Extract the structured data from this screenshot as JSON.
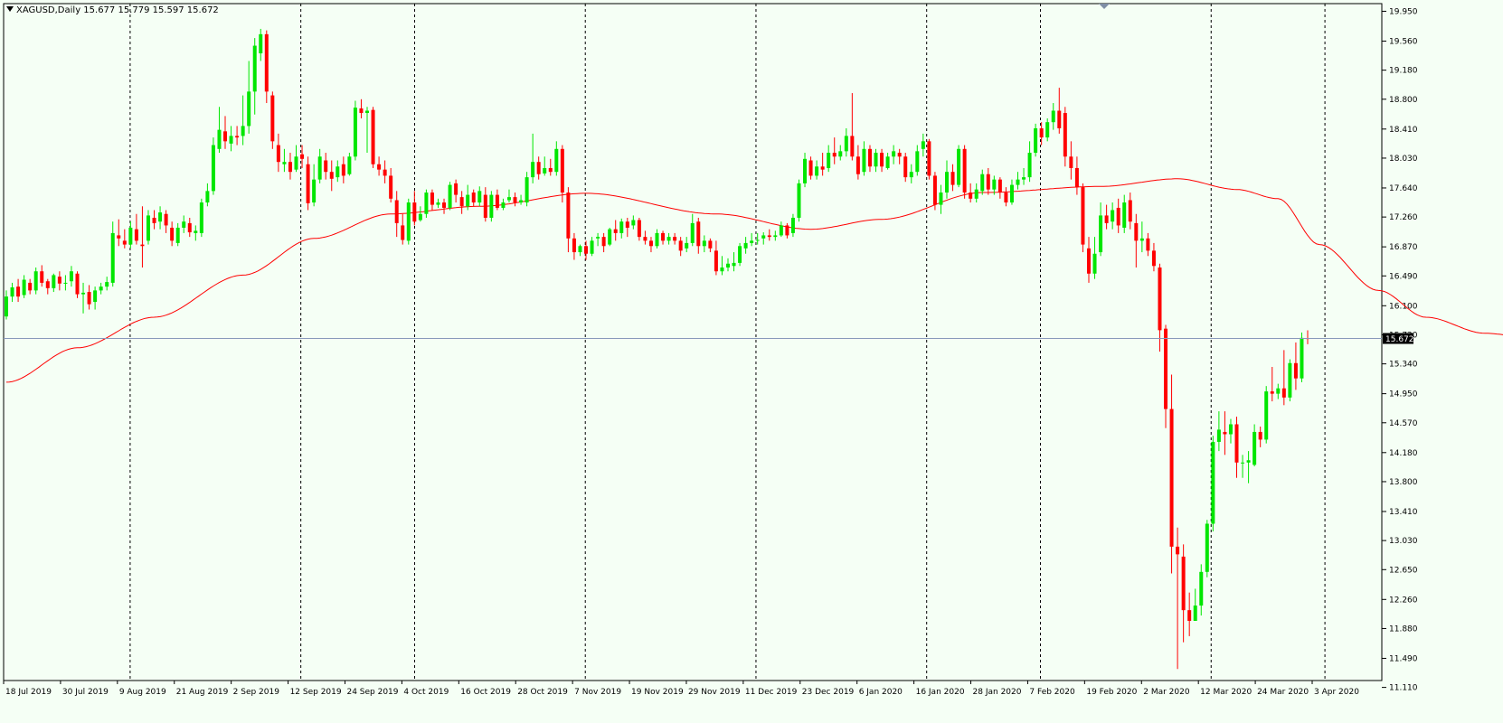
{
  "header": {
    "symbol_line": "XAGUSD,Daily  15.677 15.779 15.597 15.672"
  },
  "price_badge": "15.672",
  "colors": {
    "background": "#f5fff5",
    "bull": "#00e600",
    "bear": "#ff0000",
    "ma": "#ff0000",
    "axis": "#000000",
    "current_line": "#8899bb",
    "badge_bg": "#000000",
    "badge_fg": "#ffffff"
  },
  "chart_data": {
    "type": "candlestick",
    "symbol": "XAGUSD",
    "timeframe": "Daily",
    "ylim": [
      11.2,
      20.05
    ],
    "y_ticks": [
      "19.950",
      "19.560",
      "19.180",
      "18.800",
      "18.410",
      "18.030",
      "17.640",
      "17.260",
      "16.870",
      "16.490",
      "16.100",
      "15.720",
      "15.340",
      "14.950",
      "14.570",
      "14.180",
      "13.800",
      "13.410",
      "13.030",
      "12.650",
      "12.260",
      "11.880",
      "11.490",
      "11.110"
    ],
    "x_labels": [
      "18 Jul 2019",
      "30 Jul 2019",
      "9 Aug 2019",
      "21 Aug 2019",
      "2 Sep 2019",
      "12 Sep 2019",
      "24 Sep 2019",
      "4 Oct 2019",
      "16 Oct 2019",
      "28 Oct 2019",
      "7 Nov 2019",
      "19 Nov 2019",
      "29 Nov 2019",
      "11 Dec 2019",
      "23 Dec 2019",
      "6 Jan 2020",
      "16 Jan 2020",
      "28 Jan 2020",
      "7 Feb 2020",
      "19 Feb 2020",
      "2 Mar 2020",
      "12 Mar 2020",
      "24 Mar 2020",
      "3 Apr 2020"
    ],
    "separator_labels": [
      "30 Jul 2019",
      "2 Sep 2019",
      "24 Sep 2019",
      "28 Oct 2019",
      "29 Nov 2019",
      "6 Jan 2020",
      "28 Jan 2020",
      "2 Mar 2020",
      "24 Mar 2020"
    ],
    "last_price": 15.672,
    "ma_anchors": [
      [
        0,
        15.1
      ],
      [
        12,
        15.55
      ],
      [
        25,
        15.95
      ],
      [
        40,
        16.5
      ],
      [
        52,
        16.98
      ],
      [
        65,
        17.3
      ],
      [
        80,
        17.4
      ],
      [
        98,
        17.57
      ],
      [
        120,
        17.3
      ],
      [
        136,
        17.1
      ],
      [
        148,
        17.23
      ],
      [
        165,
        17.58
      ],
      [
        185,
        17.66
      ],
      [
        198,
        17.76
      ],
      [
        208,
        17.62
      ],
      [
        215,
        17.5
      ],
      [
        222,
        16.9
      ],
      [
        232,
        16.3
      ],
      [
        240,
        15.95
      ],
      [
        250,
        15.74
      ],
      [
        258,
        15.68
      ]
    ],
    "candles": [
      [
        15.96,
        16.22,
        15.92,
        16.3
      ],
      [
        16.22,
        16.34,
        16.15,
        16.4
      ],
      [
        16.35,
        16.22,
        16.15,
        16.45
      ],
      [
        16.24,
        16.44,
        16.2,
        16.5
      ],
      [
        16.4,
        16.3,
        16.25,
        16.45
      ],
      [
        16.3,
        16.55,
        16.25,
        16.6
      ],
      [
        16.55,
        16.4,
        16.35,
        16.63
      ],
      [
        16.42,
        16.33,
        16.25,
        16.45
      ],
      [
        16.33,
        16.5,
        16.28,
        16.52
      ],
      [
        16.48,
        16.39,
        16.3,
        16.55
      ],
      [
        16.4,
        16.4,
        16.3,
        16.5
      ],
      [
        16.42,
        16.55,
        16.35,
        16.62
      ],
      [
        16.52,
        16.25,
        16.2,
        16.55
      ],
      [
        16.25,
        16.27,
        16.0,
        16.4
      ],
      [
        16.28,
        16.12,
        16.05,
        16.37
      ],
      [
        16.15,
        16.3,
        16.05,
        16.35
      ],
      [
        16.3,
        16.35,
        16.25,
        16.4
      ],
      [
        16.35,
        16.41,
        16.3,
        16.48
      ],
      [
        16.4,
        17.05,
        16.35,
        17.2
      ],
      [
        17.02,
        16.98,
        16.88,
        17.23
      ],
      [
        16.95,
        16.9,
        16.85,
        17.1
      ],
      [
        16.9,
        17.12,
        16.85,
        17.2
      ],
      [
        17.1,
        16.95,
        16.9,
        17.3
      ],
      [
        16.9,
        16.88,
        16.6,
        17.4
      ],
      [
        16.95,
        17.28,
        16.9,
        17.35
      ],
      [
        17.25,
        17.18,
        17.1,
        17.35
      ],
      [
        17.2,
        17.32,
        17.1,
        17.4
      ],
      [
        17.3,
        17.15,
        17.05,
        17.35
      ],
      [
        17.12,
        16.95,
        16.88,
        17.2
      ],
      [
        16.92,
        17.12,
        16.88,
        17.18
      ],
      [
        17.12,
        17.2,
        17.05,
        17.28
      ],
      [
        17.18,
        17.06,
        17.0,
        17.25
      ],
      [
        17.05,
        17.08,
        16.95,
        17.15
      ],
      [
        17.05,
        17.45,
        17.0,
        17.5
      ],
      [
        17.45,
        17.6,
        17.4,
        17.7
      ],
      [
        17.6,
        18.2,
        17.55,
        18.3
      ],
      [
        18.15,
        18.4,
        18.1,
        18.7
      ],
      [
        18.38,
        18.25,
        18.15,
        18.58
      ],
      [
        18.22,
        18.32,
        18.12,
        18.45
      ],
      [
        18.32,
        18.3,
        18.2,
        18.45
      ],
      [
        18.32,
        18.45,
        18.2,
        18.85
      ],
      [
        18.45,
        18.9,
        18.35,
        19.3
      ],
      [
        18.9,
        19.5,
        18.6,
        19.6
      ],
      [
        19.4,
        19.65,
        19.3,
        19.72
      ],
      [
        19.65,
        18.9,
        18.75,
        19.7
      ],
      [
        18.85,
        18.25,
        18.15,
        18.9
      ],
      [
        18.2,
        17.98,
        17.85,
        18.35
      ],
      [
        17.95,
        17.98,
        17.85,
        18.15
      ],
      [
        17.98,
        17.85,
        17.75,
        18.1
      ],
      [
        17.88,
        18.05,
        17.85,
        18.2
      ],
      [
        18.08,
        18.02,
        17.9,
        18.2
      ],
      [
        17.95,
        17.44,
        17.35,
        18.05
      ],
      [
        17.45,
        17.75,
        17.4,
        17.95
      ],
      [
        17.75,
        18.05,
        17.7,
        18.15
      ],
      [
        18.0,
        17.85,
        17.75,
        18.1
      ],
      [
        17.85,
        17.76,
        17.6,
        18.0
      ],
      [
        17.78,
        17.92,
        17.72,
        18.0
      ],
      [
        17.95,
        17.8,
        17.7,
        18.05
      ],
      [
        17.82,
        18.05,
        17.8,
        18.1
      ],
      [
        18.05,
        18.69,
        18.0,
        18.78
      ],
      [
        18.68,
        18.62,
        18.55,
        18.8
      ],
      [
        18.62,
        18.65,
        18.1,
        18.7
      ],
      [
        18.66,
        17.95,
        17.9,
        18.7
      ],
      [
        17.95,
        17.88,
        17.8,
        18.05
      ],
      [
        17.88,
        17.8,
        17.7,
        18.0
      ],
      [
        17.8,
        17.5,
        17.45,
        17.9
      ],
      [
        17.48,
        17.18,
        17.0,
        17.6
      ],
      [
        17.15,
        16.96,
        16.9,
        17.3
      ],
      [
        16.95,
        17.45,
        16.9,
        17.5
      ],
      [
        17.45,
        17.2,
        17.15,
        17.6
      ],
      [
        17.22,
        17.3,
        17.2,
        17.4
      ],
      [
        17.3,
        17.58,
        17.25,
        17.62
      ],
      [
        17.58,
        17.42,
        17.35,
        17.62
      ],
      [
        17.42,
        17.45,
        17.38,
        17.5
      ],
      [
        17.45,
        17.38,
        17.3,
        17.5
      ],
      [
        17.38,
        17.68,
        17.35,
        17.72
      ],
      [
        17.7,
        17.55,
        17.45,
        17.75
      ],
      [
        17.52,
        17.4,
        17.3,
        17.6
      ],
      [
        17.4,
        17.55,
        17.35,
        17.68
      ],
      [
        17.58,
        17.45,
        17.4,
        17.62
      ],
      [
        17.45,
        17.6,
        17.4,
        17.66
      ],
      [
        17.55,
        17.25,
        17.2,
        17.65
      ],
      [
        17.25,
        17.55,
        17.2,
        17.6
      ],
      [
        17.55,
        17.38,
        17.35,
        17.62
      ],
      [
        17.38,
        17.45,
        17.35,
        17.5
      ],
      [
        17.48,
        17.52,
        17.45,
        17.62
      ],
      [
        17.52,
        17.45,
        17.4,
        17.58
      ],
      [
        17.45,
        17.48,
        17.42,
        17.55
      ],
      [
        17.45,
        17.78,
        17.4,
        17.85
      ],
      [
        17.78,
        17.98,
        17.7,
        18.35
      ],
      [
        17.98,
        17.82,
        17.75,
        18.05
      ],
      [
        17.83,
        17.9,
        17.8,
        18.05
      ],
      [
        17.9,
        17.85,
        17.8,
        18.02
      ],
      [
        17.85,
        18.15,
        17.8,
        18.25
      ],
      [
        18.15,
        17.58,
        17.45,
        18.2
      ],
      [
        17.58,
        16.98,
        16.8,
        17.65
      ],
      [
        16.98,
        16.8,
        16.7,
        17.05
      ],
      [
        16.8,
        16.88,
        16.75,
        16.9
      ],
      [
        16.88,
        16.78,
        16.7,
        16.95
      ],
      [
        16.78,
        16.95,
        16.75,
        17.0
      ],
      [
        16.98,
        17.0,
        16.88,
        17.05
      ],
      [
        17.0,
        16.88,
        16.8,
        17.05
      ],
      [
        16.9,
        17.1,
        16.88,
        17.12
      ],
      [
        17.1,
        17.05,
        16.95,
        17.22
      ],
      [
        17.05,
        17.2,
        16.98,
        17.24
      ],
      [
        17.2,
        17.12,
        17.0,
        17.25
      ],
      [
        17.15,
        17.22,
        17.1,
        17.28
      ],
      [
        17.22,
        17.0,
        16.95,
        17.25
      ],
      [
        17.0,
        16.95,
        16.9,
        17.08
      ],
      [
        16.95,
        16.88,
        16.8,
        17.0
      ],
      [
        16.88,
        17.05,
        16.85,
        17.1
      ],
      [
        17.05,
        16.95,
        16.9,
        17.08
      ],
      [
        16.95,
        17.0,
        16.9,
        17.05
      ],
      [
        17.0,
        16.95,
        16.9,
        17.05
      ],
      [
        16.95,
        16.82,
        16.75,
        17.0
      ],
      [
        16.85,
        16.92,
        16.8,
        17.0
      ],
      [
        16.92,
        17.18,
        16.88,
        17.3
      ],
      [
        17.2,
        16.88,
        16.78,
        17.25
      ],
      [
        16.88,
        16.95,
        16.8,
        17.02
      ],
      [
        16.95,
        16.85,
        16.8,
        16.98
      ],
      [
        16.82,
        16.55,
        16.5,
        16.95
      ],
      [
        16.55,
        16.6,
        16.5,
        16.75
      ],
      [
        16.6,
        16.65,
        16.55,
        16.72
      ],
      [
        16.62,
        16.66,
        16.55,
        16.8
      ],
      [
        16.66,
        16.88,
        16.62,
        16.92
      ],
      [
        16.85,
        16.92,
        16.78,
        17.0
      ],
      [
        16.92,
        16.95,
        16.88,
        17.05
      ],
      [
        16.95,
        16.96,
        16.9,
        17.05
      ],
      [
        16.98,
        17.02,
        16.9,
        17.06
      ],
      [
        17.02,
        17.0,
        16.95,
        17.1
      ],
      [
        17.0,
        17.02,
        16.95,
        17.08
      ],
      [
        17.02,
        17.15,
        17.0,
        17.2
      ],
      [
        17.15,
        17.02,
        16.98,
        17.18
      ],
      [
        17.05,
        17.25,
        17.0,
        17.3
      ],
      [
        17.25,
        17.7,
        17.2,
        17.75
      ],
      [
        17.7,
        18.02,
        17.65,
        18.1
      ],
      [
        18.0,
        17.8,
        17.75,
        18.05
      ],
      [
        17.8,
        17.92,
        17.75,
        18.0
      ],
      [
        17.92,
        17.88,
        17.8,
        18.1
      ],
      [
        17.9,
        18.1,
        17.85,
        18.2
      ],
      [
        18.1,
        18.05,
        17.95,
        18.3
      ],
      [
        18.05,
        18.12,
        18.0,
        18.2
      ],
      [
        18.12,
        18.32,
        18.05,
        18.42
      ],
      [
        18.32,
        18.05,
        18.0,
        18.88
      ],
      [
        18.05,
        17.82,
        17.75,
        18.2
      ],
      [
        17.85,
        18.15,
        17.8,
        18.25
      ],
      [
        18.15,
        17.92,
        17.85,
        18.2
      ],
      [
        17.92,
        18.1,
        17.85,
        18.15
      ],
      [
        18.1,
        17.92,
        17.85,
        18.15
      ],
      [
        17.9,
        18.05,
        17.88,
        18.1
      ],
      [
        18.05,
        18.12,
        17.95,
        18.2
      ],
      [
        18.1,
        18.05,
        17.95,
        18.15
      ],
      [
        18.05,
        17.78,
        17.72,
        18.1
      ],
      [
        17.78,
        17.85,
        17.7,
        17.95
      ],
      [
        17.85,
        18.12,
        17.8,
        18.2
      ],
      [
        18.15,
        18.25,
        18.05,
        18.35
      ],
      [
        18.25,
        17.8,
        17.75,
        18.28
      ],
      [
        17.8,
        17.42,
        17.35,
        17.85
      ],
      [
        17.42,
        17.58,
        17.3,
        17.68
      ],
      [
        17.58,
        17.85,
        17.5,
        18.0
      ],
      [
        17.85,
        17.68,
        17.6,
        17.95
      ],
      [
        17.68,
        18.15,
        17.65,
        18.2
      ],
      [
        18.15,
        17.58,
        17.5,
        18.2
      ],
      [
        17.58,
        17.5,
        17.45,
        17.7
      ],
      [
        17.5,
        17.62,
        17.45,
        17.7
      ],
      [
        17.6,
        17.82,
        17.55,
        17.88
      ],
      [
        17.82,
        17.62,
        17.55,
        17.9
      ],
      [
        17.62,
        17.75,
        17.55,
        17.8
      ],
      [
        17.75,
        17.58,
        17.5,
        17.78
      ],
      [
        17.58,
        17.45,
        17.4,
        17.65
      ],
      [
        17.45,
        17.68,
        17.42,
        17.75
      ],
      [
        17.68,
        17.75,
        17.62,
        17.85
      ],
      [
        17.75,
        17.78,
        17.68,
        17.9
      ],
      [
        17.78,
        18.1,
        17.72,
        18.25
      ],
      [
        18.1,
        18.42,
        18.05,
        18.48
      ],
      [
        18.42,
        18.3,
        18.2,
        18.5
      ],
      [
        18.3,
        18.5,
        18.25,
        18.55
      ],
      [
        18.5,
        18.65,
        18.4,
        18.75
      ],
      [
        18.65,
        18.42,
        18.35,
        18.95
      ],
      [
        18.62,
        18.05,
        17.92,
        18.7
      ],
      [
        18.05,
        17.9,
        17.75,
        18.25
      ],
      [
        17.9,
        17.65,
        17.55,
        18.05
      ],
      [
        17.65,
        16.9,
        16.8,
        17.7
      ],
      [
        16.85,
        16.52,
        16.4,
        17.0
      ],
      [
        16.52,
        16.78,
        16.45,
        17.0
      ],
      [
        16.8,
        17.28,
        16.75,
        17.45
      ],
      [
        17.28,
        17.18,
        17.1,
        17.42
      ],
      [
        17.2,
        17.35,
        17.1,
        17.45
      ],
      [
        17.38,
        17.15,
        17.05,
        17.5
      ],
      [
        17.12,
        17.45,
        17.05,
        17.55
      ],
      [
        17.48,
        17.2,
        17.1,
        17.58
      ],
      [
        17.18,
        16.95,
        16.6,
        17.3
      ],
      [
        16.95,
        16.98,
        16.8,
        17.2
      ],
      [
        16.98,
        16.82,
        16.75,
        17.05
      ],
      [
        16.82,
        16.62,
        16.55,
        16.92
      ],
      [
        16.6,
        15.78,
        15.5,
        16.65
      ],
      [
        15.8,
        14.75,
        14.5,
        15.85
      ],
      [
        14.75,
        12.95,
        12.6,
        15.2
      ],
      [
        12.95,
        12.85,
        11.35,
        13.2
      ],
      [
        12.82,
        12.12,
        11.7,
        12.98
      ],
      [
        12.12,
        11.98,
        11.78,
        12.35
      ],
      [
        11.98,
        12.18,
        11.98,
        12.4
      ],
      [
        12.18,
        12.62,
        12.05,
        12.72
      ],
      [
        12.62,
        13.25,
        12.55,
        13.3
      ],
      [
        13.25,
        14.32,
        13.15,
        14.4
      ],
      [
        14.32,
        14.48,
        14.2,
        14.72
      ],
      [
        14.45,
        14.42,
        14.15,
        14.72
      ],
      [
        14.42,
        14.55,
        14.3,
        14.62
      ],
      [
        14.55,
        14.05,
        13.85,
        14.65
      ],
      [
        14.05,
        14.05,
        13.85,
        14.15
      ],
      [
        14.05,
        14.08,
        13.78,
        14.2
      ],
      [
        14.02,
        14.45,
        14.0,
        14.55
      ],
      [
        14.45,
        14.35,
        14.25,
        14.52
      ],
      [
        14.35,
        14.98,
        14.3,
        15.05
      ],
      [
        14.98,
        14.95,
        14.85,
        15.3
      ],
      [
        14.95,
        15.02,
        14.88,
        15.08
      ],
      [
        15.02,
        14.9,
        14.8,
        15.52
      ],
      [
        14.9,
        15.35,
        14.85,
        15.4
      ],
      [
        15.35,
        15.15,
        15.0,
        15.62
      ],
      [
        15.15,
        15.68,
        15.1,
        15.75
      ],
      [
        15.677,
        15.672,
        15.597,
        15.779
      ]
    ]
  }
}
